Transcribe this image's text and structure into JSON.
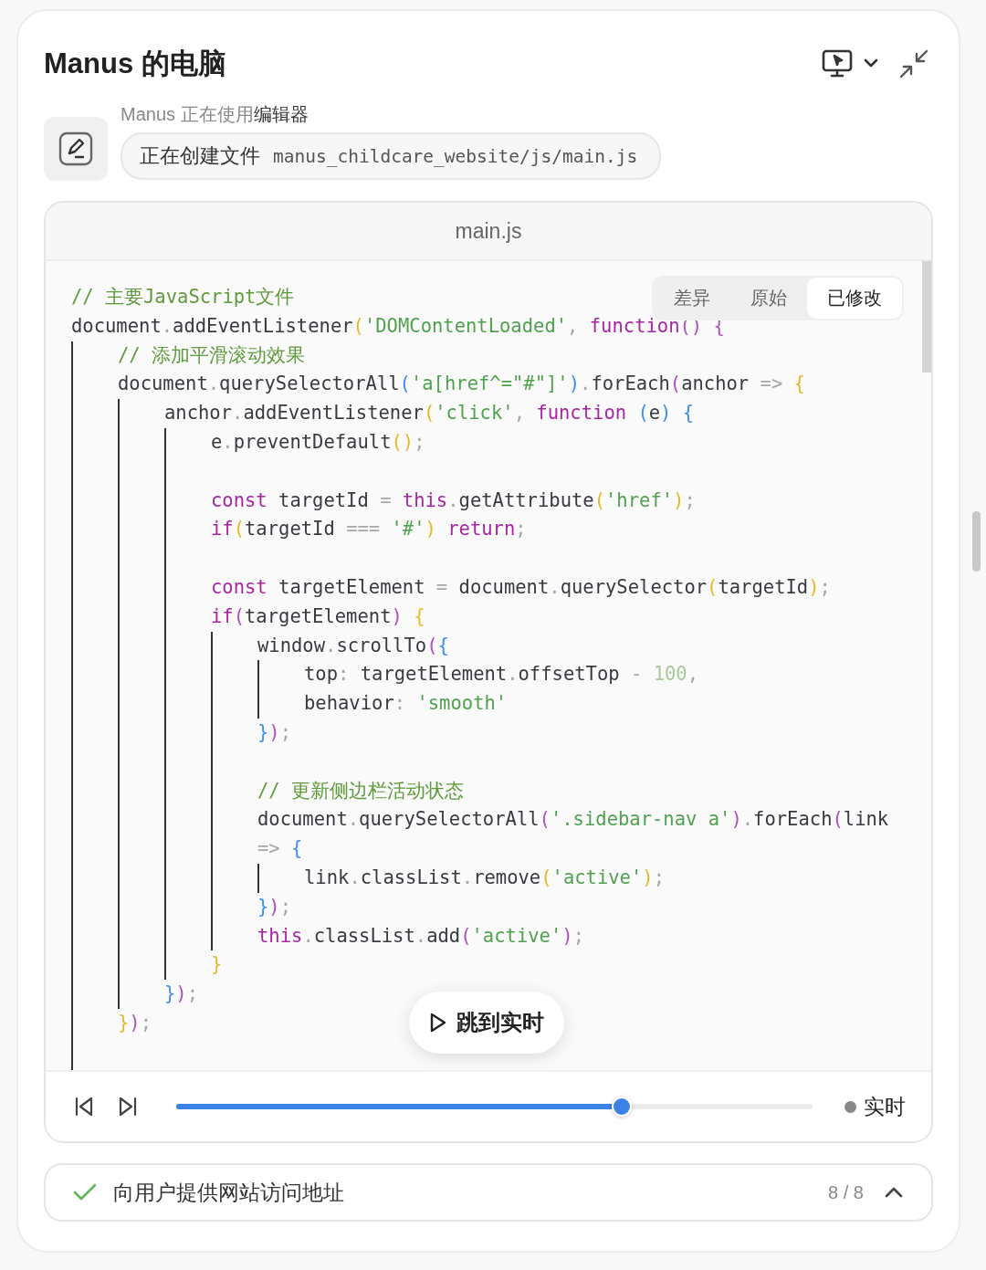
{
  "window": {
    "title": "Manus 的电脑"
  },
  "activity": {
    "label_prefix": "Manus 正在使用",
    "label_tool": "编辑器",
    "action": "正在创建文件",
    "path": "manus_childcare_website/js/main.js"
  },
  "editor": {
    "filename": "main.js",
    "view_tabs": [
      {
        "label": "差异",
        "selected": false
      },
      {
        "label": "原始",
        "selected": false
      },
      {
        "label": "已修改",
        "selected": true
      }
    ],
    "lines": [
      {
        "kind": "code",
        "tokens": [
          {
            "kind": "comment",
            "text": "// 主要JavaScript文件"
          }
        ]
      },
      {
        "kind": "code",
        "tokens": [
          {
            "kind": "plain",
            "text": "document"
          },
          {
            "kind": "punct",
            "text": "."
          },
          {
            "kind": "plain",
            "text": "addEventListener"
          },
          {
            "kind": "paren1",
            "text": "("
          },
          {
            "kind": "string",
            "text": "'DOMContentLoaded'"
          },
          {
            "kind": "punct",
            "text": ", "
          },
          {
            "kind": "keyword",
            "text": "function"
          },
          {
            "kind": "paren2",
            "text": "() {"
          }
        ],
        "children": [
          {
            "kind": "code",
            "tokens": [
              {
                "kind": "comment",
                "text": "// 添加平滑滚动效果"
              }
            ]
          },
          {
            "kind": "code",
            "tokens": [
              {
                "kind": "plain",
                "text": "document"
              },
              {
                "kind": "punct",
                "text": "."
              },
              {
                "kind": "plain",
                "text": "querySelectorAll"
              },
              {
                "kind": "paren3",
                "text": "("
              },
              {
                "kind": "string",
                "text": "'a[href^=\"#\"]'"
              },
              {
                "kind": "paren3",
                "text": ")"
              },
              {
                "kind": "punct",
                "text": "."
              },
              {
                "kind": "plain",
                "text": "forEach"
              },
              {
                "kind": "paren2",
                "text": "("
              },
              {
                "kind": "plain",
                "text": "anchor "
              },
              {
                "kind": "punct",
                "text": "=> "
              },
              {
                "kind": "paren1",
                "text": "{"
              }
            ],
            "children": [
              {
                "kind": "code",
                "tokens": [
                  {
                    "kind": "plain",
                    "text": "anchor"
                  },
                  {
                    "kind": "punct",
                    "text": "."
                  },
                  {
                    "kind": "plain",
                    "text": "addEventListener"
                  },
                  {
                    "kind": "paren1",
                    "text": "("
                  },
                  {
                    "kind": "string",
                    "text": "'click'"
                  },
                  {
                    "kind": "punct",
                    "text": ", "
                  },
                  {
                    "kind": "keyword",
                    "text": "function "
                  },
                  {
                    "kind": "paren3",
                    "text": "("
                  },
                  {
                    "kind": "plain",
                    "text": "e"
                  },
                  {
                    "kind": "paren3",
                    "text": ") {"
                  }
                ],
                "children": [
                  {
                    "kind": "code",
                    "tokens": [
                      {
                        "kind": "plain",
                        "text": "e"
                      },
                      {
                        "kind": "punct",
                        "text": "."
                      },
                      {
                        "kind": "plain",
                        "text": "preventDefault"
                      },
                      {
                        "kind": "paren1",
                        "text": "()"
                      },
                      {
                        "kind": "punct",
                        "text": ";"
                      }
                    ]
                  },
                  {
                    "kind": "blank"
                  },
                  {
                    "kind": "code",
                    "tokens": [
                      {
                        "kind": "keyword",
                        "text": "const "
                      },
                      {
                        "kind": "plain",
                        "text": "targetId "
                      },
                      {
                        "kind": "punct",
                        "text": "= "
                      },
                      {
                        "kind": "keyword",
                        "text": "this"
                      },
                      {
                        "kind": "punct",
                        "text": "."
                      },
                      {
                        "kind": "plain",
                        "text": "getAttribute"
                      },
                      {
                        "kind": "paren1",
                        "text": "("
                      },
                      {
                        "kind": "string",
                        "text": "'href'"
                      },
                      {
                        "kind": "paren1",
                        "text": ")"
                      },
                      {
                        "kind": "punct",
                        "text": ";"
                      }
                    ]
                  },
                  {
                    "kind": "code",
                    "tokens": [
                      {
                        "kind": "keyword",
                        "text": "if"
                      },
                      {
                        "kind": "paren1",
                        "text": "("
                      },
                      {
                        "kind": "plain",
                        "text": "targetId "
                      },
                      {
                        "kind": "punct",
                        "text": "=== "
                      },
                      {
                        "kind": "string",
                        "text": "'#'"
                      },
                      {
                        "kind": "paren1",
                        "text": ") "
                      },
                      {
                        "kind": "keyword",
                        "text": "return"
                      },
                      {
                        "kind": "punct",
                        "text": ";"
                      }
                    ]
                  },
                  {
                    "kind": "blank"
                  },
                  {
                    "kind": "code",
                    "tokens": [
                      {
                        "kind": "keyword",
                        "text": "const "
                      },
                      {
                        "kind": "plain",
                        "text": "targetElement "
                      },
                      {
                        "kind": "punct",
                        "text": "= "
                      },
                      {
                        "kind": "plain",
                        "text": "document"
                      },
                      {
                        "kind": "punct",
                        "text": "."
                      },
                      {
                        "kind": "plain",
                        "text": "querySelector"
                      },
                      {
                        "kind": "paren1",
                        "text": "("
                      },
                      {
                        "kind": "plain",
                        "text": "targetId"
                      },
                      {
                        "kind": "paren1",
                        "text": ")"
                      },
                      {
                        "kind": "punct",
                        "text": ";"
                      }
                    ]
                  },
                  {
                    "kind": "code",
                    "tokens": [
                      {
                        "kind": "keyword",
                        "text": "if"
                      },
                      {
                        "kind": "paren2",
                        "text": "("
                      },
                      {
                        "kind": "plain",
                        "text": "targetElement"
                      },
                      {
                        "kind": "paren2",
                        "text": ") "
                      },
                      {
                        "kind": "paren1",
                        "text": "{"
                      }
                    ],
                    "children": [
                      {
                        "kind": "code",
                        "tokens": [
                          {
                            "kind": "plain",
                            "text": "window"
                          },
                          {
                            "kind": "punct",
                            "text": "."
                          },
                          {
                            "kind": "plain",
                            "text": "scrollTo"
                          },
                          {
                            "kind": "paren2",
                            "text": "("
                          },
                          {
                            "kind": "paren3",
                            "text": "{"
                          }
                        ],
                        "children": [
                          {
                            "kind": "code",
                            "tokens": [
                              {
                                "kind": "plain",
                                "text": "top"
                              },
                              {
                                "kind": "punct",
                                "text": ": "
                              },
                              {
                                "kind": "plain",
                                "text": "targetElement"
                              },
                              {
                                "kind": "punct",
                                "text": "."
                              },
                              {
                                "kind": "plain",
                                "text": "offsetTop "
                              },
                              {
                                "kind": "punct",
                                "text": "- "
                              },
                              {
                                "kind": "number",
                                "text": "100"
                              },
                              {
                                "kind": "punct",
                                "text": ","
                              }
                            ]
                          },
                          {
                            "kind": "code",
                            "tokens": [
                              {
                                "kind": "plain",
                                "text": "behavior"
                              },
                              {
                                "kind": "punct",
                                "text": ": "
                              },
                              {
                                "kind": "string",
                                "text": "'smooth'"
                              }
                            ]
                          }
                        ]
                      },
                      {
                        "kind": "code",
                        "tokens": [
                          {
                            "kind": "paren3",
                            "text": "}"
                          },
                          {
                            "kind": "paren2",
                            "text": ")"
                          },
                          {
                            "kind": "punct",
                            "text": ";"
                          }
                        ]
                      },
                      {
                        "kind": "blank"
                      },
                      {
                        "kind": "code",
                        "tokens": [
                          {
                            "kind": "comment",
                            "text": "// 更新侧边栏活动状态"
                          }
                        ]
                      },
                      {
                        "kind": "code",
                        "tokens": [
                          {
                            "kind": "plain",
                            "text": "document"
                          },
                          {
                            "kind": "punct",
                            "text": "."
                          },
                          {
                            "kind": "plain",
                            "text": "querySelectorAll"
                          },
                          {
                            "kind": "paren2",
                            "text": "("
                          },
                          {
                            "kind": "string",
                            "text": "'.sidebar-nav a'"
                          },
                          {
                            "kind": "paren2",
                            "text": ")"
                          },
                          {
                            "kind": "punct",
                            "text": "."
                          },
                          {
                            "kind": "plain",
                            "text": "forEach"
                          },
                          {
                            "kind": "paren2",
                            "text": "("
                          },
                          {
                            "kind": "plain",
                            "text": "link"
                          }
                        ]
                      },
                      {
                        "kind": "code",
                        "tokens": [
                          {
                            "kind": "punct",
                            "text": "=> "
                          },
                          {
                            "kind": "paren3",
                            "text": "{"
                          }
                        ],
                        "children": [
                          {
                            "kind": "code",
                            "tokens": [
                              {
                                "kind": "plain",
                                "text": "link"
                              },
                              {
                                "kind": "punct",
                                "text": "."
                              },
                              {
                                "kind": "plain",
                                "text": "classList"
                              },
                              {
                                "kind": "punct",
                                "text": "."
                              },
                              {
                                "kind": "plain",
                                "text": "remove"
                              },
                              {
                                "kind": "paren1",
                                "text": "("
                              },
                              {
                                "kind": "string",
                                "text": "'active'"
                              },
                              {
                                "kind": "paren1",
                                "text": ")"
                              },
                              {
                                "kind": "punct",
                                "text": ";"
                              }
                            ]
                          }
                        ]
                      },
                      {
                        "kind": "code",
                        "tokens": [
                          {
                            "kind": "paren3",
                            "text": "}"
                          },
                          {
                            "kind": "paren2",
                            "text": ")"
                          },
                          {
                            "kind": "punct",
                            "text": ";"
                          }
                        ]
                      },
                      {
                        "kind": "code",
                        "tokens": [
                          {
                            "kind": "keyword",
                            "text": "this"
                          },
                          {
                            "kind": "punct",
                            "text": "."
                          },
                          {
                            "kind": "plain",
                            "text": "classList"
                          },
                          {
                            "kind": "punct",
                            "text": "."
                          },
                          {
                            "kind": "plain",
                            "text": "add"
                          },
                          {
                            "kind": "paren2",
                            "text": "("
                          },
                          {
                            "kind": "string",
                            "text": "'active'"
                          },
                          {
                            "kind": "paren2",
                            "text": ")"
                          },
                          {
                            "kind": "punct",
                            "text": ";"
                          }
                        ]
                      }
                    ]
                  },
                  {
                    "kind": "code",
                    "tokens": [
                      {
                        "kind": "paren1",
                        "text": "}"
                      }
                    ]
                  }
                ]
              },
              {
                "kind": "code",
                "tokens": [
                  {
                    "kind": "paren3",
                    "text": "}"
                  },
                  {
                    "kind": "paren2",
                    "text": ")"
                  },
                  {
                    "kind": "punct",
                    "text": ";"
                  }
                ]
              }
            ]
          },
          {
            "kind": "code",
            "tokens": [
              {
                "kind": "paren1",
                "text": "}"
              },
              {
                "kind": "paren2",
                "text": ")"
              },
              {
                "kind": "punct",
                "text": ";"
              }
            ]
          }
        ]
      }
    ],
    "jump_button": "跳到实时",
    "playback": {
      "level": 0.7,
      "live_label": "实时"
    }
  },
  "step": {
    "done": true,
    "label": "向用户提供网站访问地址",
    "counter": "8 / 8"
  }
}
